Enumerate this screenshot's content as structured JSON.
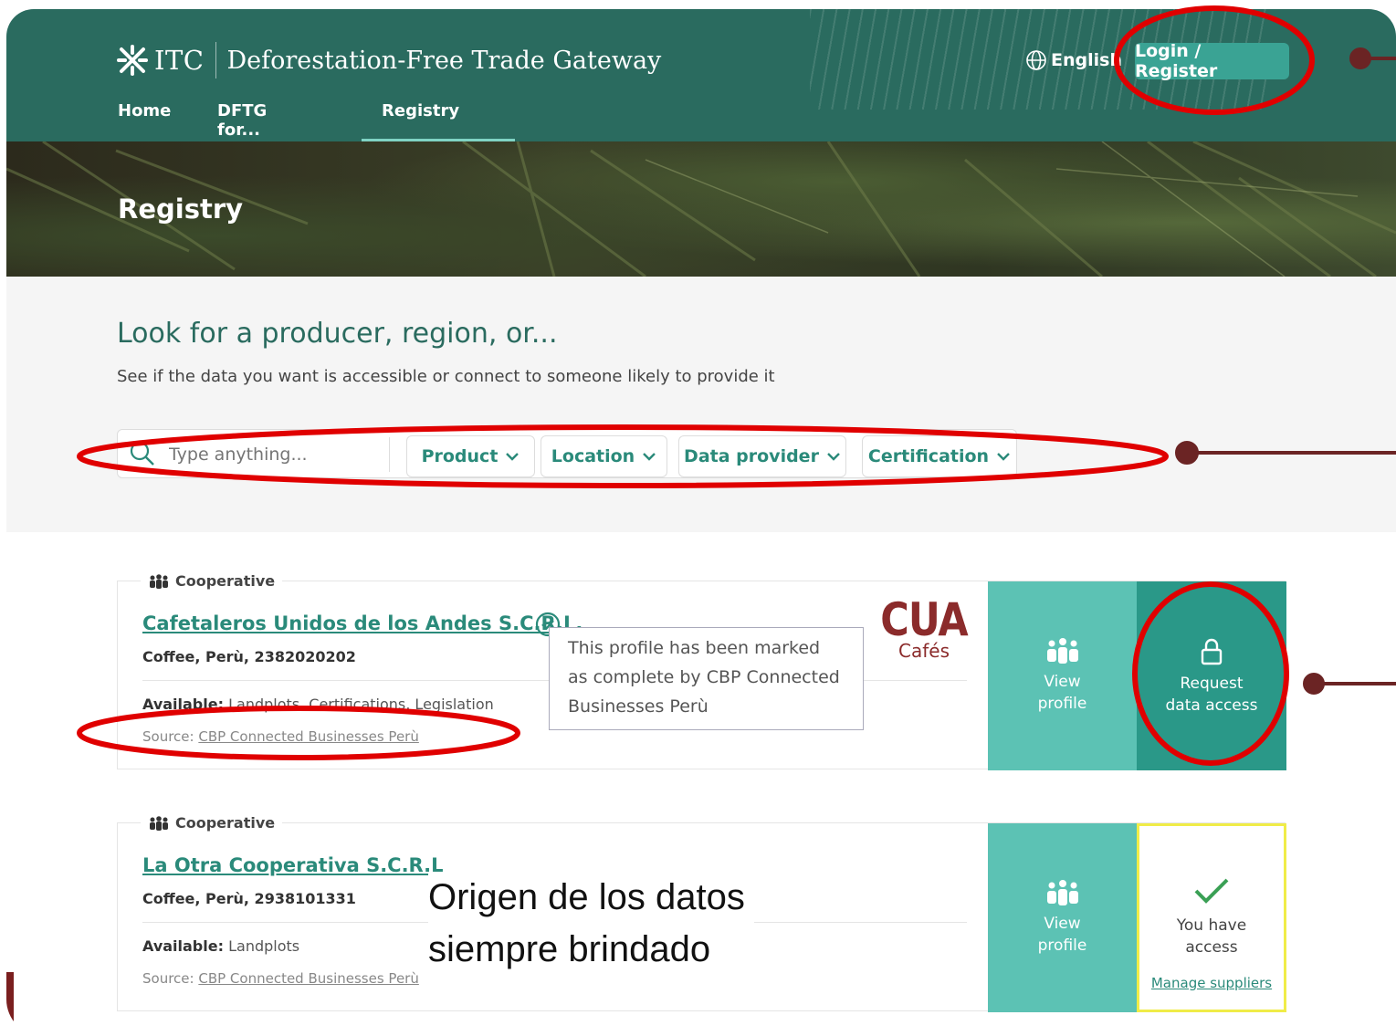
{
  "header": {
    "logo_text": "ITC",
    "site_title": "Deforestation-Free Trade Gateway",
    "nav": [
      {
        "label": "Home"
      },
      {
        "label": "DFTG for..."
      },
      {
        "label": "Registry"
      }
    ],
    "language": "English",
    "login_label": "Login / Register"
  },
  "hero": {
    "title": "Registry"
  },
  "search": {
    "headline": "Look for a producer, region, or...",
    "subtitle": "See if the data you want is accessible or connect to someone likely to provide it",
    "placeholder": "Type anything...",
    "filters": [
      "Product",
      "Location",
      "Data provider",
      "Certification"
    ]
  },
  "results": [
    {
      "type": "Cooperative",
      "name": "Cafetaleros Unidos de los Andes S.C.R.L.",
      "meta": "Coffee, Perù, 2382020202",
      "available_label": "Available:",
      "available_value": "Landplots, Certifications, Legislation",
      "source_label": "Source:",
      "source_value": "CBP Connected Businesses Perù",
      "view_label_1": "View",
      "view_label_2": "profile",
      "request_label_1": "Request",
      "request_label_2": "data access",
      "brand_logo": "CUA",
      "brand_sub": "Cafés",
      "tooltip": "This profile has been marked as complete by CBP Connected Businesses Perù"
    },
    {
      "type": "Cooperative",
      "name": "La Otra Cooperativa S.C.R.L",
      "meta": "Coffee, Perù, 2938101331",
      "available_label": "Available:",
      "available_value": "Landplots",
      "source_label": "Source:",
      "source_value": "CBP Connected Businesses Perù",
      "view_label_1": "View",
      "view_label_2": "profile",
      "access_label_1": "You have",
      "access_label_2": "access",
      "manage_label": "Manage suppliers"
    }
  ],
  "annotation": {
    "line1": "Origen de los datos",
    "line2": "siempre brindado",
    "highlight_color": "#e00000"
  }
}
